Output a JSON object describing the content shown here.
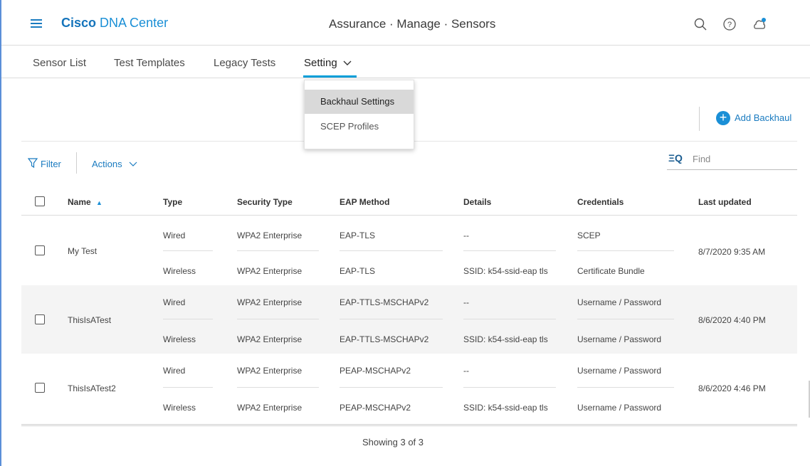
{
  "header": {
    "brand_bold": "Cisco",
    "brand_rest": "DNA Center",
    "title": "Assurance · Manage · Sensors",
    "icons": [
      "menu-icon",
      "search-icon",
      "help-icon",
      "notification-icon"
    ]
  },
  "tabs": [
    {
      "label": "Sensor List"
    },
    {
      "label": "Test Templates"
    },
    {
      "label": "Legacy Tests"
    },
    {
      "label": "Setting"
    }
  ],
  "dropdown": {
    "items": [
      {
        "label": "Backhaul Settings",
        "selected": true
      },
      {
        "label": "SCEP Profiles",
        "selected": false
      }
    ]
  },
  "toolbar": {
    "add_label": "Add Backhaul",
    "filter_label": "Filter",
    "actions_label": "Actions",
    "find_placeholder": "Find"
  },
  "table": {
    "columns": [
      "Name",
      "Type",
      "Security Type",
      "EAP Method",
      "Details",
      "Credentials",
      "Last updated"
    ],
    "sort_indicator": "▲",
    "rows": [
      {
        "name": "My Test",
        "last_updated": "8/7/2020 9:35 AM",
        "sub": [
          {
            "type": "Wired",
            "security": "WPA2 Enterprise",
            "eap": "EAP-TLS",
            "details": "--",
            "credentials": "SCEP"
          },
          {
            "type": "Wireless",
            "security": "WPA2 Enterprise",
            "eap": "EAP-TLS",
            "details": "SSID: k54-ssid-eap tls",
            "credentials": "Certificate Bundle"
          }
        ]
      },
      {
        "name": "ThisIsATest",
        "last_updated": "8/6/2020 4:40 PM",
        "sub": [
          {
            "type": "Wired",
            "security": "WPA2 Enterprise",
            "eap": "EAP-TTLS-MSCHAPv2",
            "details": "--",
            "credentials": "Username / Password"
          },
          {
            "type": "Wireless",
            "security": "WPA2 Enterprise",
            "eap": "EAP-TTLS-MSCHAPv2",
            "details": "SSID: k54-ssid-eap tls",
            "credentials": "Username / Password"
          }
        ]
      },
      {
        "name": "ThisIsATest2",
        "last_updated": "8/6/2020 4:46 PM",
        "sub": [
          {
            "type": "Wired",
            "security": "WPA2 Enterprise",
            "eap": "PEAP-MSCHAPv2",
            "details": "--",
            "credentials": "Username / Password"
          },
          {
            "type": "Wireless",
            "security": "WPA2 Enterprise",
            "eap": "PEAP-MSCHAPv2",
            "details": "SSID: k54-ssid-eap tls",
            "credentials": "Username / Password"
          }
        ]
      }
    ],
    "footer": "Showing 3 of 3"
  },
  "colors": {
    "accent": "#049fd9",
    "link": "#1a7bc0",
    "row_shade": "#f4f4f4"
  }
}
